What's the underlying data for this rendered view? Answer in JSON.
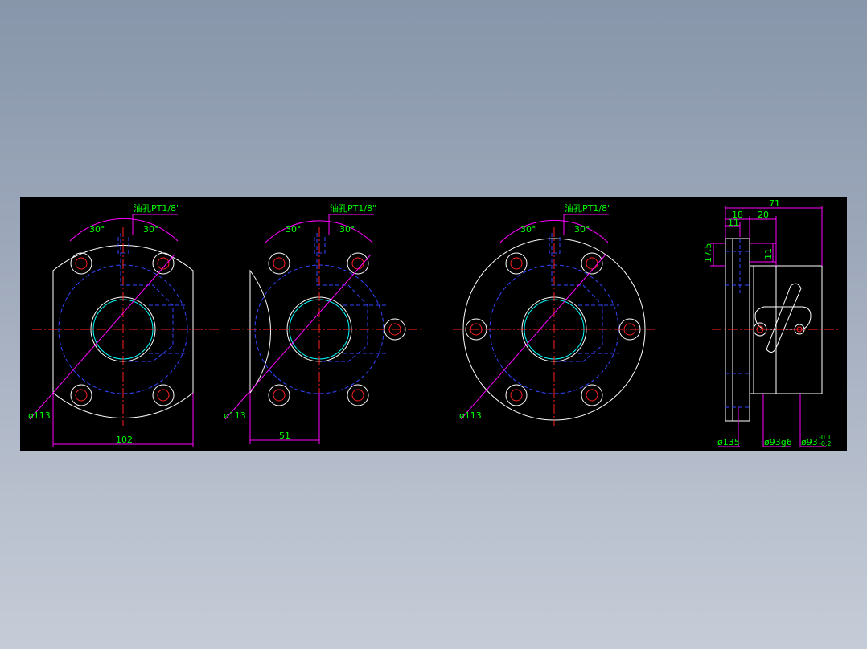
{
  "views": [
    {
      "oil_label": "油孔PT1/8\"",
      "angle_left": "30°",
      "angle_right": "30°",
      "pcd_label": "ø113",
      "width_dim": "102"
    },
    {
      "oil_label": "油孔PT1/8\"",
      "angle_left": "30°",
      "angle_right": "30°",
      "pcd_label": "ø113",
      "offset_dim": "51"
    },
    {
      "oil_label": "油孔PT1/8\"",
      "angle_left": "30°",
      "angle_right": "30°",
      "pcd_label": "ø113"
    }
  ],
  "side_view": {
    "length_dim": "71",
    "flange_dim": "18",
    "step_dim": "20",
    "thin_dim": "11",
    "height_dim": "17.5",
    "hole_dim": "11",
    "flange_dia": "ø135",
    "body_dia": "ø93g6",
    "recess_dia": "ø93",
    "recess_tol_upper": "-0.1",
    "recess_tol_lower": "-0.2"
  },
  "colors": {
    "background_outer": "#8796aa",
    "viewport": "#000000",
    "outline": "#ffffff",
    "hidden": "#3344ff",
    "center": "#ff2020",
    "dimension": "#ff00ff",
    "text": "#00ff00",
    "cyan": "#00ffff"
  }
}
